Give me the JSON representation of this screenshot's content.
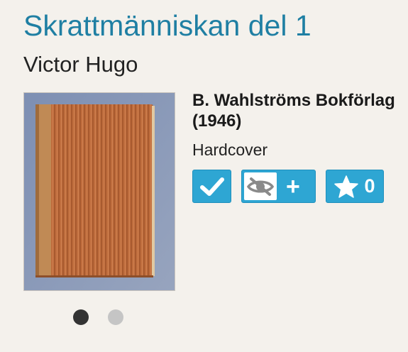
{
  "book": {
    "title": "Skrattmänniskan del 1",
    "author": "Victor Hugo",
    "publisher": "B. Wahlströms Bokförlag (1946)",
    "format": "Hardcover"
  },
  "actions": {
    "owned_icon": "check-icon",
    "watch_icon": "eye-slash-icon",
    "watch_add_label": "+",
    "favorite_icon": "star-icon",
    "favorite_count": "0"
  },
  "gallery": {
    "current_image": 1,
    "image_count": 2
  },
  "colors": {
    "title": "#1f7fa3",
    "button": "#2ea6d3",
    "background": "#f4f1ec"
  }
}
